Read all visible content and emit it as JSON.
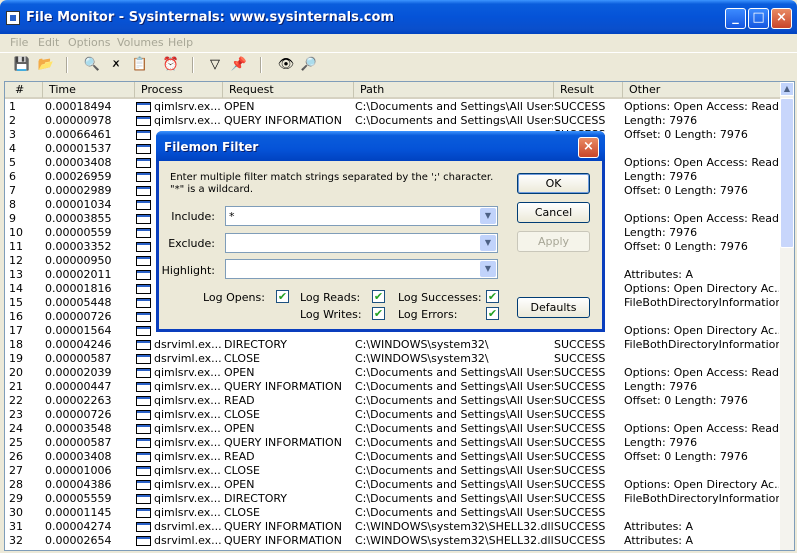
{
  "window": {
    "title": "File Monitor - Sysinternals: www.sysinternals.com",
    "minimize_glyph": "_",
    "maximize_glyph": "□",
    "close_glyph": "×"
  },
  "menu": [
    "File",
    "Edit",
    "Options",
    "Volumes",
    "Help"
  ],
  "toolbar": {
    "icons": [
      "save-icon",
      "open-icon",
      "capture-icon",
      "autoscroll-icon",
      "clear-icon",
      "time-icon",
      "filter-icon",
      "highlight-icon",
      "find-icon",
      "jump-icon"
    ],
    "glyphs": [
      "💾",
      "📂",
      "🔍",
      "🗶",
      "📋",
      "⏰",
      "▽",
      "📌",
      "👁",
      "🔎"
    ]
  },
  "list": {
    "columns": [
      "#",
      "Time",
      "Process",
      "Request",
      "Path",
      "Result",
      "Other"
    ],
    "rows": [
      [
        "1",
        "0.00018494",
        "qimlsrv.ex...",
        "OPEN",
        "C:\\Documents and Settings\\All Users\\i...",
        "SUCCESS",
        "Options: Open  Access: Read"
      ],
      [
        "2",
        "0.00000978",
        "qimlsrv.ex...",
        "QUERY INFORMATION",
        "C:\\Documents and Settings\\All Users\\i...",
        "SUCCESS",
        "Length: 7976"
      ],
      [
        "3",
        "0.00066461",
        "",
        "",
        "",
        "SUCCESS",
        "Offset: 0 Length: 7976"
      ],
      [
        "4",
        "0.00001537",
        "",
        "",
        "",
        "",
        ""
      ],
      [
        "5",
        "0.00003408",
        "",
        "",
        "",
        "",
        "Options: Open  Access: Read"
      ],
      [
        "6",
        "0.00026959",
        "",
        "",
        "",
        "",
        "Length: 7976"
      ],
      [
        "7",
        "0.00002989",
        "",
        "",
        "",
        "",
        "Offset: 0 Length: 7976"
      ],
      [
        "8",
        "0.00001034",
        "",
        "",
        "",
        "",
        ""
      ],
      [
        "9",
        "0.00003855",
        "",
        "",
        "",
        "",
        "Options: Open  Access: Read"
      ],
      [
        "10",
        "0.00000559",
        "",
        "",
        "",
        "",
        "Length: 7976"
      ],
      [
        "11",
        "0.00003352",
        "",
        "",
        "",
        "",
        "Offset: 0 Length: 7976"
      ],
      [
        "12",
        "0.00000950",
        "",
        "",
        "",
        "",
        ""
      ],
      [
        "13",
        "0.00002011",
        "",
        "",
        "",
        "",
        "Attributes: A"
      ],
      [
        "14",
        "0.00001816",
        "",
        "",
        "",
        "",
        "Options: Open Directory  Ac..."
      ],
      [
        "15",
        "0.00005448",
        "",
        "",
        "",
        "",
        "FileBothDirectoryInformation:..."
      ],
      [
        "16",
        "0.00000726",
        "",
        "",
        "",
        "",
        ""
      ],
      [
        "17",
        "0.00001564",
        "",
        "",
        "",
        "",
        "Options: Open Directory  Ac..."
      ],
      [
        "18",
        "0.00004246",
        "dsrviml.ex...",
        "DIRECTORY",
        "C:\\WINDOWS\\system32\\",
        "SUCCESS",
        "FileBothDirectoryInformation:..."
      ],
      [
        "19",
        "0.00000587",
        "dsrviml.ex...",
        "CLOSE",
        "C:\\WINDOWS\\system32\\",
        "SUCCESS",
        ""
      ],
      [
        "20",
        "0.00002039",
        "qimlsrv.ex...",
        "OPEN",
        "C:\\Documents and Settings\\All Users\\i...",
        "SUCCESS",
        "Options: Open  Access: Read"
      ],
      [
        "21",
        "0.00000447",
        "qimlsrv.ex...",
        "QUERY INFORMATION",
        "C:\\Documents and Settings\\All Users\\i...",
        "SUCCESS",
        "Length: 7976"
      ],
      [
        "22",
        "0.00002263",
        "qimlsrv.ex...",
        "READ",
        "C:\\Documents and Settings\\All Users\\i...",
        "SUCCESS",
        "Offset: 0 Length: 7976"
      ],
      [
        "23",
        "0.00000726",
        "qimlsrv.ex...",
        "CLOSE",
        "C:\\Documents and Settings\\All Users\\i...",
        "SUCCESS",
        ""
      ],
      [
        "24",
        "0.00003548",
        "qimlsrv.ex...",
        "OPEN",
        "C:\\Documents and Settings\\All Users\\i...",
        "SUCCESS",
        "Options: Open  Access: Read"
      ],
      [
        "25",
        "0.00000587",
        "qimlsrv.ex...",
        "QUERY INFORMATION",
        "C:\\Documents and Settings\\All Users\\i...",
        "SUCCESS",
        "Length: 7976"
      ],
      [
        "26",
        "0.00003408",
        "qimlsrv.ex...",
        "READ",
        "C:\\Documents and Settings\\All Users\\i...",
        "SUCCESS",
        "Offset: 0 Length: 7976"
      ],
      [
        "27",
        "0.00001006",
        "qimlsrv.ex...",
        "CLOSE",
        "C:\\Documents and Settings\\All Users\\i...",
        "SUCCESS",
        ""
      ],
      [
        "28",
        "0.00004386",
        "qimlsrv.ex...",
        "OPEN",
        "C:\\Documents and Settings\\All Users\\",
        "SUCCESS",
        "Options: Open Directory  Ac..."
      ],
      [
        "29",
        "0.00005559",
        "qimlsrv.ex...",
        "DIRECTORY",
        "C:\\Documents and Settings\\All Users\\",
        "SUCCESS",
        "FileBothDirectoryInformation:..."
      ],
      [
        "30",
        "0.00001145",
        "qimlsrv.ex...",
        "CLOSE",
        "C:\\Documents and Settings\\All Users\\",
        "SUCCESS",
        ""
      ],
      [
        "31",
        "0.00004274",
        "dsrviml.ex...",
        "QUERY INFORMATION",
        "C:\\WINDOWS\\system32\\SHELL32.dll",
        "SUCCESS",
        "Attributes: A"
      ],
      [
        "32",
        "0.00002654",
        "dsrviml.ex...",
        "QUERY INFORMATION",
        "C:\\WINDOWS\\system32\\SHELL32.dll",
        "SUCCESS",
        "Attributes: A"
      ]
    ],
    "scroll_up_glyph": "▲"
  },
  "filter_dialog": {
    "title": "Filemon Filter",
    "close_glyph": "×",
    "instructions": "Enter multiple filter match strings separated by the ';' character. \"*\" is a wildcard.",
    "include_label": "Include:",
    "include_value": "*",
    "exclude_label": "Exclude:",
    "exclude_value": "",
    "highlight_label": "Highlight:",
    "highlight_value": "",
    "dropdown_glyph": "▼",
    "check_glyph": "✔",
    "checkboxes": [
      {
        "label": "Log Opens:",
        "checked": true
      },
      {
        "label": "Log Reads:",
        "checked": true
      },
      {
        "label": "Log Successes:",
        "checked": true
      },
      {
        "label": "Log Writes:",
        "checked": true
      },
      {
        "label": "Log Errors:",
        "checked": true
      }
    ],
    "ok_label": "OK",
    "cancel_label": "Cancel",
    "apply_label": "Apply",
    "defaults_label": "Defaults"
  }
}
